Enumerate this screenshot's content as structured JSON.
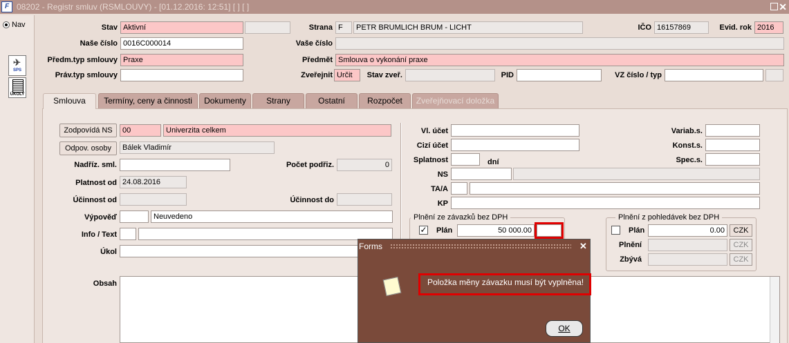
{
  "window": {
    "title": "08202 - Registr smluv (RSMLOUVY) - [01.12.2016: 12:51]  [ ]  [ ]",
    "app_icon": "F"
  },
  "nav": {
    "label": "Nav",
    "buttons": [
      "SPS",
      "ÚKOLY"
    ]
  },
  "header": {
    "stav": {
      "label": "Stav",
      "value": "Aktivní",
      "extra": ""
    },
    "nase_cislo": {
      "label": "Naše číslo",
      "value": "0016C000014"
    },
    "predm_typ": {
      "label": "Předm.typ smlouvy",
      "value": "Praxe"
    },
    "prav_typ": {
      "label": "Práv.typ smlouvy",
      "value": ""
    },
    "strana": {
      "label": "Strana",
      "code": "F",
      "value": "PETR BRUMLICH BRUM - LICHT"
    },
    "vase_cislo": {
      "label": "Vaše číslo",
      "value": ""
    },
    "predmet": {
      "label": "Předmět",
      "value": "Smlouva o vykonání praxe"
    },
    "zverejnit": {
      "label": "Zveřejnit",
      "value": "Určit"
    },
    "stav_zver": {
      "label": "Stav zveř.",
      "value": ""
    },
    "pid": {
      "label": "PID",
      "value": ""
    },
    "vz_cislo": {
      "label": "VZ číslo / typ",
      "value": "",
      "typ": ""
    },
    "ico": {
      "label": "IČO",
      "value": "16157869"
    },
    "evid_rok": {
      "label": "Evid. rok",
      "value": "2016"
    }
  },
  "tabs": [
    "Smlouva",
    "Termíny, ceny a činnosti",
    "Dokumenty",
    "Strany",
    "Ostatní",
    "Rozpočet",
    "Zveřejňovací doložka"
  ],
  "smlouva": {
    "zodpovida_ns": {
      "label": "Zodpovídá NS",
      "code": "00",
      "value": "Univerzita celkem"
    },
    "odpov_osoby": {
      "label": "Odpov. osoby",
      "value": "Bálek Vladimír"
    },
    "nadriz_sml": {
      "label": "Nadříz. sml.",
      "value": ""
    },
    "pocet_podriz": {
      "label": "Počet podřiz.",
      "value": "0"
    },
    "platnost_od": {
      "label": "Platnost od",
      "value": "24.08.2016"
    },
    "ucinnost_od": {
      "label": "Účinnost od",
      "value": ""
    },
    "ucinnost_do": {
      "label": "Účinnost do",
      "value": ""
    },
    "vypoved": {
      "label": "Výpověď",
      "code": "",
      "value": "Neuvedeno"
    },
    "info_text": {
      "label": "Info / Text",
      "code": "",
      "value": ""
    },
    "ukol": {
      "label": "Úkol",
      "value": ""
    },
    "obsah": {
      "label": "Obsah",
      "value": ""
    },
    "vl_ucet": {
      "label": "Vl. účet",
      "value": ""
    },
    "cizi_ucet": {
      "label": "Cizí účet",
      "value": ""
    },
    "splatnost": {
      "label": "Splatnost",
      "value": "",
      "unit": "dní"
    },
    "ns": {
      "label": "NS",
      "value": "",
      "desc": ""
    },
    "ta_a": {
      "label": "TA/A",
      "value": "",
      "desc": ""
    },
    "kp": {
      "label": "KP",
      "value": ""
    },
    "variab_s": {
      "label": "Variab.s.",
      "value": ""
    },
    "konst_s": {
      "label": "Konst.s.",
      "value": ""
    },
    "spec_s": {
      "label": "Spec.s.",
      "value": ""
    },
    "plneni_zavazku": {
      "title": "Plnění ze závazků bez DPH",
      "plan_label": "Plán",
      "plan_checked": true,
      "plan_value": "50 000.00",
      "mena": ""
    },
    "plneni_pohledavek": {
      "title": "Plnění z pohledávek bez DPH",
      "plan_label": "Plán",
      "plan_checked": false,
      "plan_value": "0.00",
      "plan_mena": "CZK",
      "plneni_label": "Plnění",
      "plneni_value": "",
      "plneni_mena": "CZK",
      "zbyva_label": "Zbývá",
      "zbyva_value": "",
      "zbyva_mena": "CZK"
    }
  },
  "dialog": {
    "title": "Forms",
    "message": "Položka měny závazku musí být vyplněna!",
    "ok_label": "OK"
  },
  "colors": {
    "required": "#fcc7c7",
    "titlebar": "#b49189",
    "dialog": "#7a4a3a",
    "highlight": "#e00000"
  }
}
